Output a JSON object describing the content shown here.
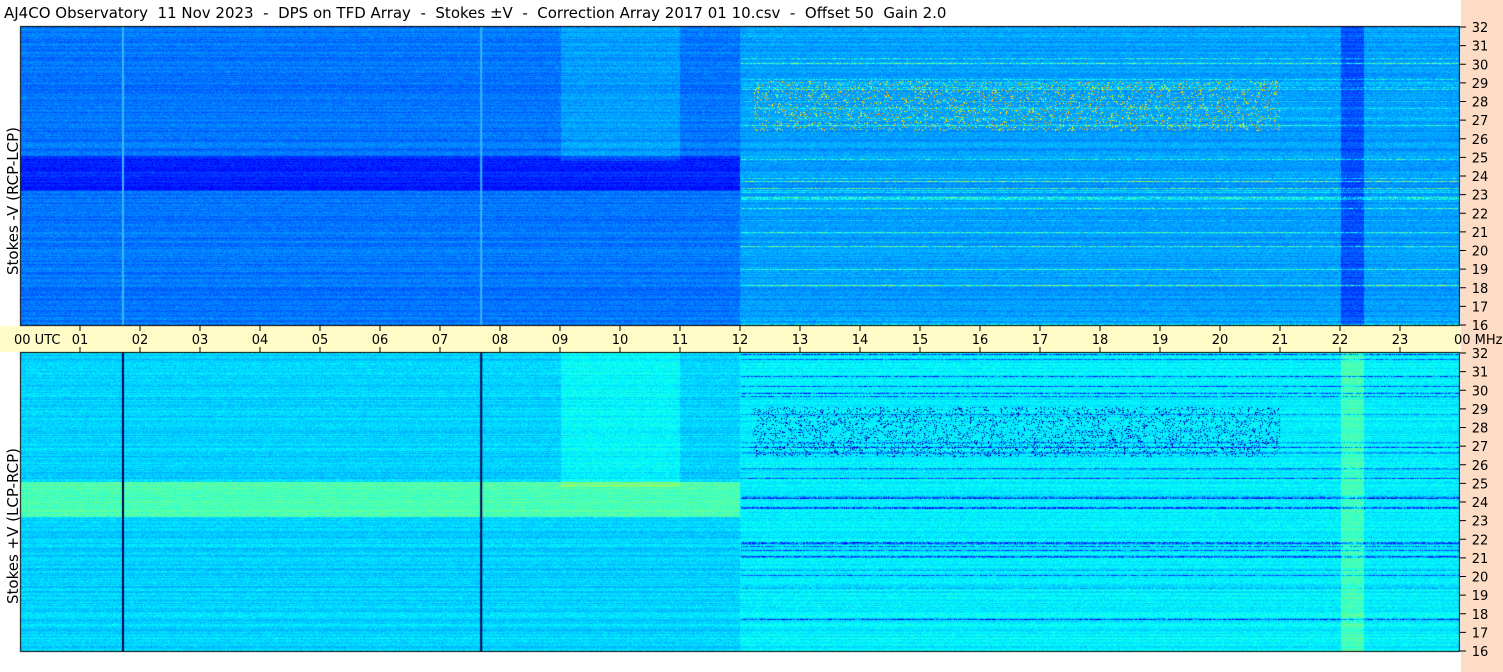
{
  "title": "AJ4CO Observatory  11 Nov 2023  -  DPS on TFD Array  -  Stokes ±V  -  Correction Array 2017 01 10.csv  -  Offset 50  Gain 2.0",
  "colors": {
    "axis_band": "#fffcc8",
    "right_strip": "#fcdcc4",
    "background_dark_blue": "#1e46c8",
    "background_light_blue": "#2a8cf0"
  },
  "chart_data": [
    {
      "type": "heatmap",
      "name": "upper-panel",
      "ylabel": "Stokes -V (RCP-LCP)",
      "y_unit": "MHz",
      "ylim": [
        16,
        32
      ],
      "yticks": [
        "32",
        "31",
        "30",
        "29",
        "28",
        "27",
        "26",
        "25",
        "24",
        "23",
        "22",
        "21",
        "20",
        "19",
        "18",
        "17",
        "16"
      ],
      "xlim": [
        0,
        24
      ]
    },
    {
      "type": "heatmap",
      "name": "lower-panel",
      "ylabel": "Stokes +V (LCP-RCP)",
      "y_unit": "MHz",
      "ylim": [
        16,
        32
      ],
      "yticks": [
        "32",
        "31",
        "30",
        "29",
        "28",
        "27",
        "26",
        "25",
        "24",
        "23",
        "22",
        "21",
        "20",
        "19",
        "18",
        "17",
        "16"
      ],
      "xlim": [
        0,
        24
      ]
    }
  ],
  "time_axis": {
    "start_label": "00 UTC",
    "ticks": [
      "01",
      "02",
      "03",
      "04",
      "05",
      "06",
      "07",
      "08",
      "09",
      "10",
      "11",
      "12",
      "13",
      "14",
      "15",
      "16",
      "17",
      "18",
      "19",
      "20",
      "21",
      "22",
      "23"
    ],
    "end_label": "00 MHz"
  }
}
